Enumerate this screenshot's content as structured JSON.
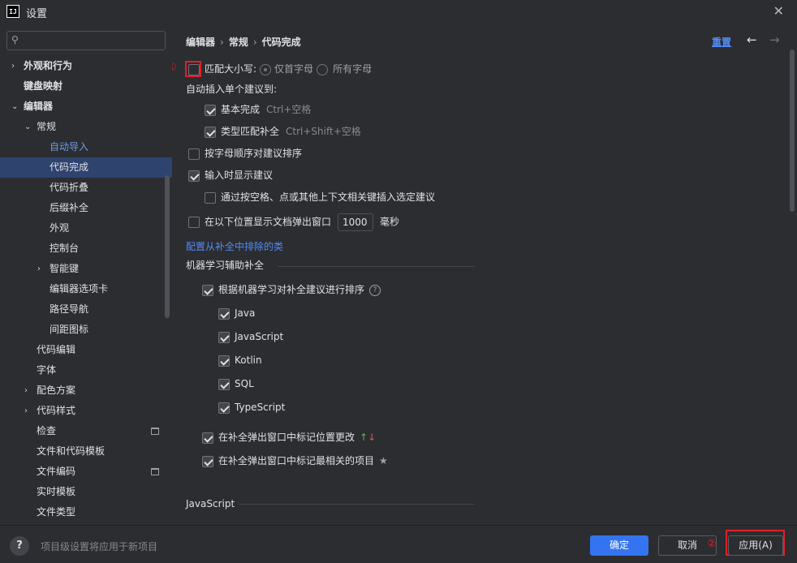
{
  "window": {
    "title": "设置",
    "app_icon": "IJ"
  },
  "search": {
    "placeholder": ""
  },
  "sidebar": {
    "items": [
      {
        "label": "外观和行为",
        "chevron": "›",
        "bold": true
      },
      {
        "label": "键盘映射",
        "bold": true
      },
      {
        "label": "编辑器",
        "chevron": "⌄",
        "bold": true
      },
      {
        "label": "常规",
        "chevron": "⌄"
      },
      {
        "label": "自动导入",
        "accent": true
      },
      {
        "label": "代码完成",
        "selected": true
      },
      {
        "label": "代码折叠"
      },
      {
        "label": "后缀补全"
      },
      {
        "label": "外观"
      },
      {
        "label": "控制台"
      },
      {
        "label": "智能键",
        "chevron": "›"
      },
      {
        "label": "编辑器选项卡"
      },
      {
        "label": "路径导航"
      },
      {
        "label": "间距图标"
      },
      {
        "label": "代码编辑"
      },
      {
        "label": "字体"
      },
      {
        "label": "配色方案",
        "chevron": "›"
      },
      {
        "label": "代码样式",
        "chevron": "›"
      },
      {
        "label": "检查"
      },
      {
        "label": "文件和代码模板"
      },
      {
        "label": "文件编码"
      },
      {
        "label": "实时模板"
      },
      {
        "label": "文件类型"
      }
    ]
  },
  "breadcrumb": {
    "part1": "编辑器",
    "part2": "常规",
    "part3": "代码完成",
    "sep": "›"
  },
  "header": {
    "reset": "重置",
    "back": "←",
    "forward": "→"
  },
  "options": {
    "marker1": "①",
    "match_case": "匹配大小写:",
    "first_letter": "仅首字母",
    "all_letters": "所有字母",
    "auto_insert": "自动插入单个建议到:",
    "basic": "基本完成",
    "basic_hint": "Ctrl+空格",
    "type_match": "类型匹配补全",
    "type_match_hint": "Ctrl+Shift+空格",
    "sort_alpha": "按字母顺序对建议排序",
    "show_typing": "输入时显示建议",
    "insert_by_space": "通过按空格、点或其他上下文相关键插入选定建议",
    "show_doc": "在以下位置显示文档弹出窗口",
    "doc_delay": "1000",
    "ms": "毫秒",
    "exclude_link": "配置从补全中排除的类",
    "ml_section": "机器学习辅助补全",
    "ml_sort": "根据机器学习对补全建议进行排序",
    "help_glyph": "?",
    "java": "Java",
    "javascript": "JavaScript",
    "kotlin": "Kotlin",
    "sql": "SQL",
    "typescript": "TypeScript",
    "mark_position": "在补全弹出窗口中标记位置更改",
    "arrow_up": "↑",
    "arrow_down": "↓",
    "mark_relevant": "在补全弹出窗口中标记最相关的项目",
    "star": "★",
    "js_section": "JavaScript"
  },
  "footer": {
    "help": "?",
    "note": "项目级设置将应用于新项目",
    "ok": "确定",
    "cancel": "取消",
    "marker2": "②",
    "apply": "应用(A)"
  },
  "colors": {
    "accent": "#548af7",
    "selected": "#2e436e",
    "primary_button": "#3574f0",
    "highlight_box": "#e0202a"
  }
}
